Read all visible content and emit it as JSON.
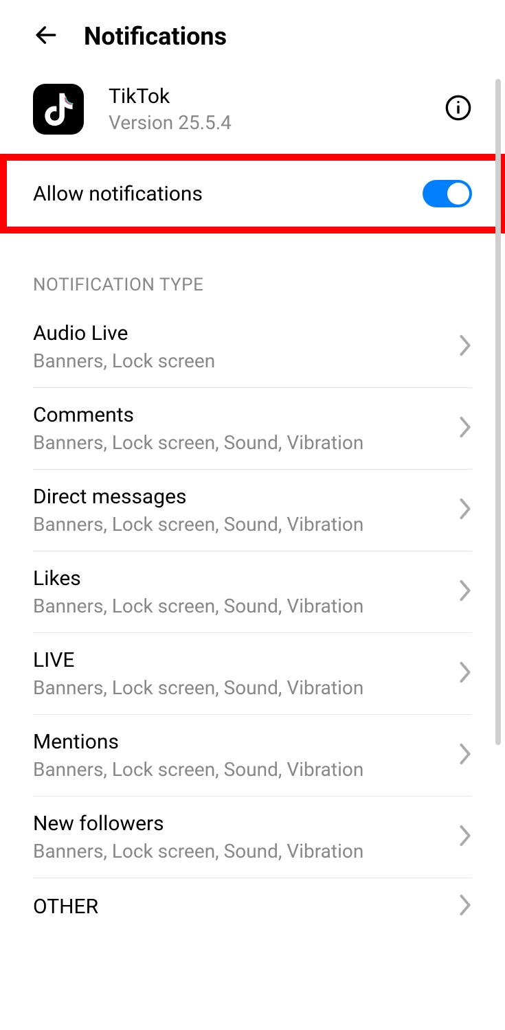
{
  "header": {
    "title": "Notifications"
  },
  "app": {
    "name": "TikTok",
    "version": "Version 25.5.4"
  },
  "allow": {
    "label": "Allow notifications",
    "enabled": true
  },
  "section_header": "NOTIFICATION TYPE",
  "types": [
    {
      "title": "Audio Live",
      "sub": "Banners, Lock screen"
    },
    {
      "title": "Comments",
      "sub": "Banners, Lock screen, Sound, Vibration"
    },
    {
      "title": "Direct messages",
      "sub": "Banners, Lock screen, Sound, Vibration"
    },
    {
      "title": "Likes",
      "sub": "Banners, Lock screen, Sound, Vibration"
    },
    {
      "title": "LIVE",
      "sub": "Banners, Lock screen, Sound, Vibration"
    },
    {
      "title": "Mentions",
      "sub": "Banners, Lock screen, Sound, Vibration"
    },
    {
      "title": "New followers",
      "sub": "Banners, Lock screen, Sound, Vibration"
    },
    {
      "title": "OTHER",
      "sub": ""
    }
  ]
}
